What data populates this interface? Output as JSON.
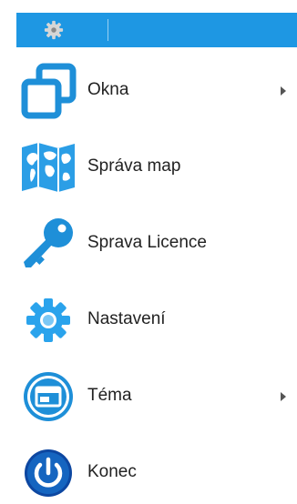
{
  "toolbar": {
    "settings_icon": "gear-icon"
  },
  "menu": {
    "items": [
      {
        "label": "Okna",
        "icon": "windows-icon",
        "has_submenu": true
      },
      {
        "label": "Správa map",
        "icon": "map-icon",
        "has_submenu": false
      },
      {
        "label": "Sprava Licence",
        "icon": "key-icon",
        "has_submenu": false
      },
      {
        "label": "Nastavení",
        "icon": "gear-icon",
        "has_submenu": false
      },
      {
        "label": "Téma",
        "icon": "theme-icon",
        "has_submenu": true
      },
      {
        "label": "Konec",
        "icon": "power-icon",
        "has_submenu": false
      }
    ]
  },
  "colors": {
    "accent": "#1e97e3",
    "power": "#1565c0"
  }
}
